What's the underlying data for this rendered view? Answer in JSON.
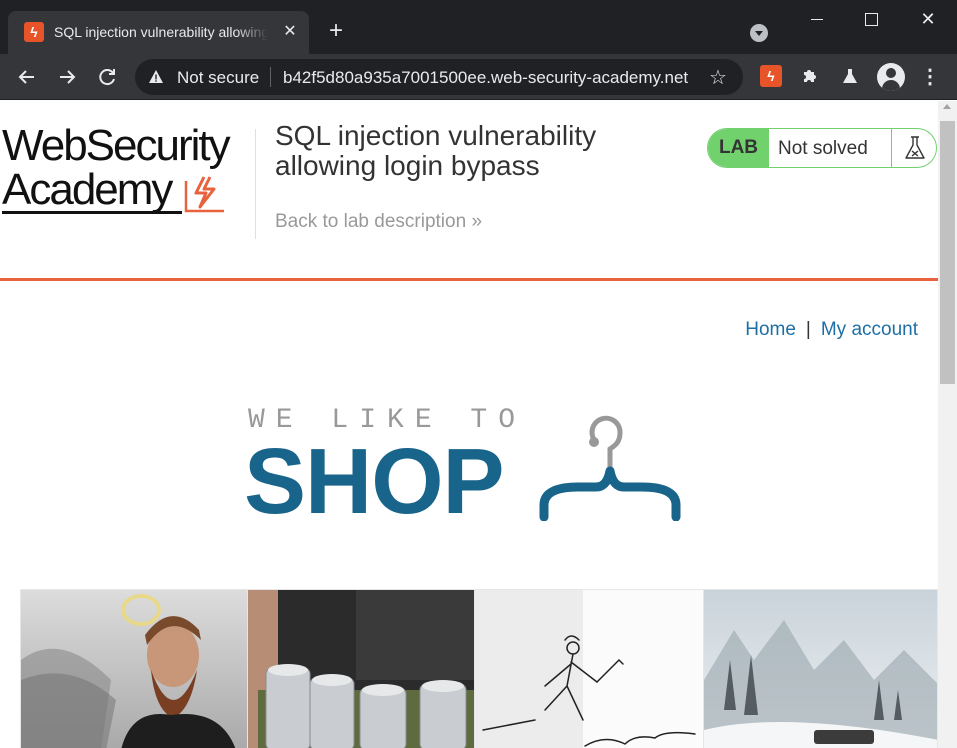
{
  "browser": {
    "tab_title": "SQL injection vulnerability allowing login bypass",
    "new_tab": "+",
    "close": "✕",
    "not_secure": "Not secure",
    "url": "b42f5d80a935a7001500ee.web-security-academy.net",
    "icons": [
      "back-icon",
      "forward-icon",
      "reload-icon",
      "warning-icon",
      "star-icon",
      "burp-extension-icon",
      "puzzle-icon",
      "labs-flask-icon",
      "profile-icon",
      "menu-icon"
    ]
  },
  "header": {
    "logo_line1": "WebSecurity",
    "logo_line2": "Academy",
    "lab_title": "SQL injection vulnerability allowing login bypass",
    "back_link": "Back to lab description",
    "back_chevron": "»",
    "lab_tag": "LAB",
    "lab_status": "Not solved"
  },
  "nav": {
    "home": "Home",
    "separator": "|",
    "my_account": "My account"
  },
  "banner": {
    "tagline": "WE LIKE TO",
    "shop": "SHOP"
  },
  "products": [
    {
      "image": "man-with-halo-and-wings"
    },
    {
      "image": "beer-can-belt"
    },
    {
      "image": "sketch-figure-with-umbrella"
    },
    {
      "image": "snowy-forest"
    }
  ],
  "colors": {
    "accent_orange": "#e8623d",
    "lab_green": "#70d16d",
    "link_blue": "#1d6fa5",
    "shop_blue": "#19648a"
  }
}
